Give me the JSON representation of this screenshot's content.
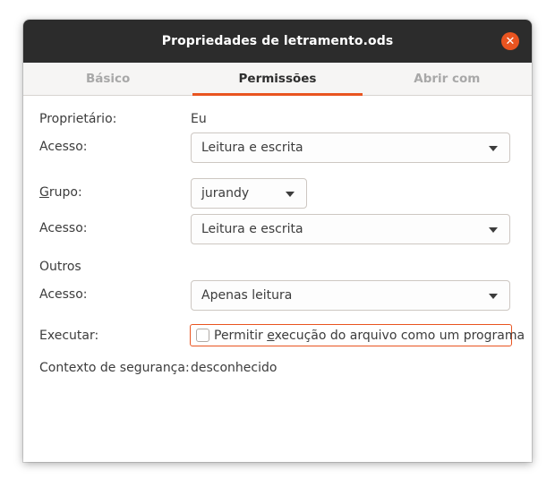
{
  "window": {
    "title": "Propriedades de letramento.ods",
    "close_glyph": "✕"
  },
  "tabs": [
    {
      "label": "Básico",
      "active": false
    },
    {
      "label": "Permissões",
      "active": true
    },
    {
      "label": "Abrir com",
      "active": false
    }
  ],
  "owner": {
    "label": "Proprietário:",
    "value": "Eu",
    "access_label": "Acesso:",
    "access_value": "Leitura e escrita"
  },
  "group": {
    "label_prefix": "G",
    "label_rest": "rupo:",
    "value": "jurandy",
    "access_label": "Acesso:",
    "access_value": "Leitura e escrita"
  },
  "others": {
    "label": "Outros",
    "access_label": "Acesso:",
    "access_value": "Apenas leitura"
  },
  "execute": {
    "label": "Executar:",
    "checkbox_text_before": "Permitir ",
    "checkbox_text_mnemonic": "e",
    "checkbox_text_after": "xecução do arquivo como um programa",
    "checked": false
  },
  "security": {
    "label": "Contexto de segurança:",
    "value": "desconhecido"
  },
  "colors": {
    "accent": "#e95420",
    "titlebar": "#2c2c2c"
  }
}
